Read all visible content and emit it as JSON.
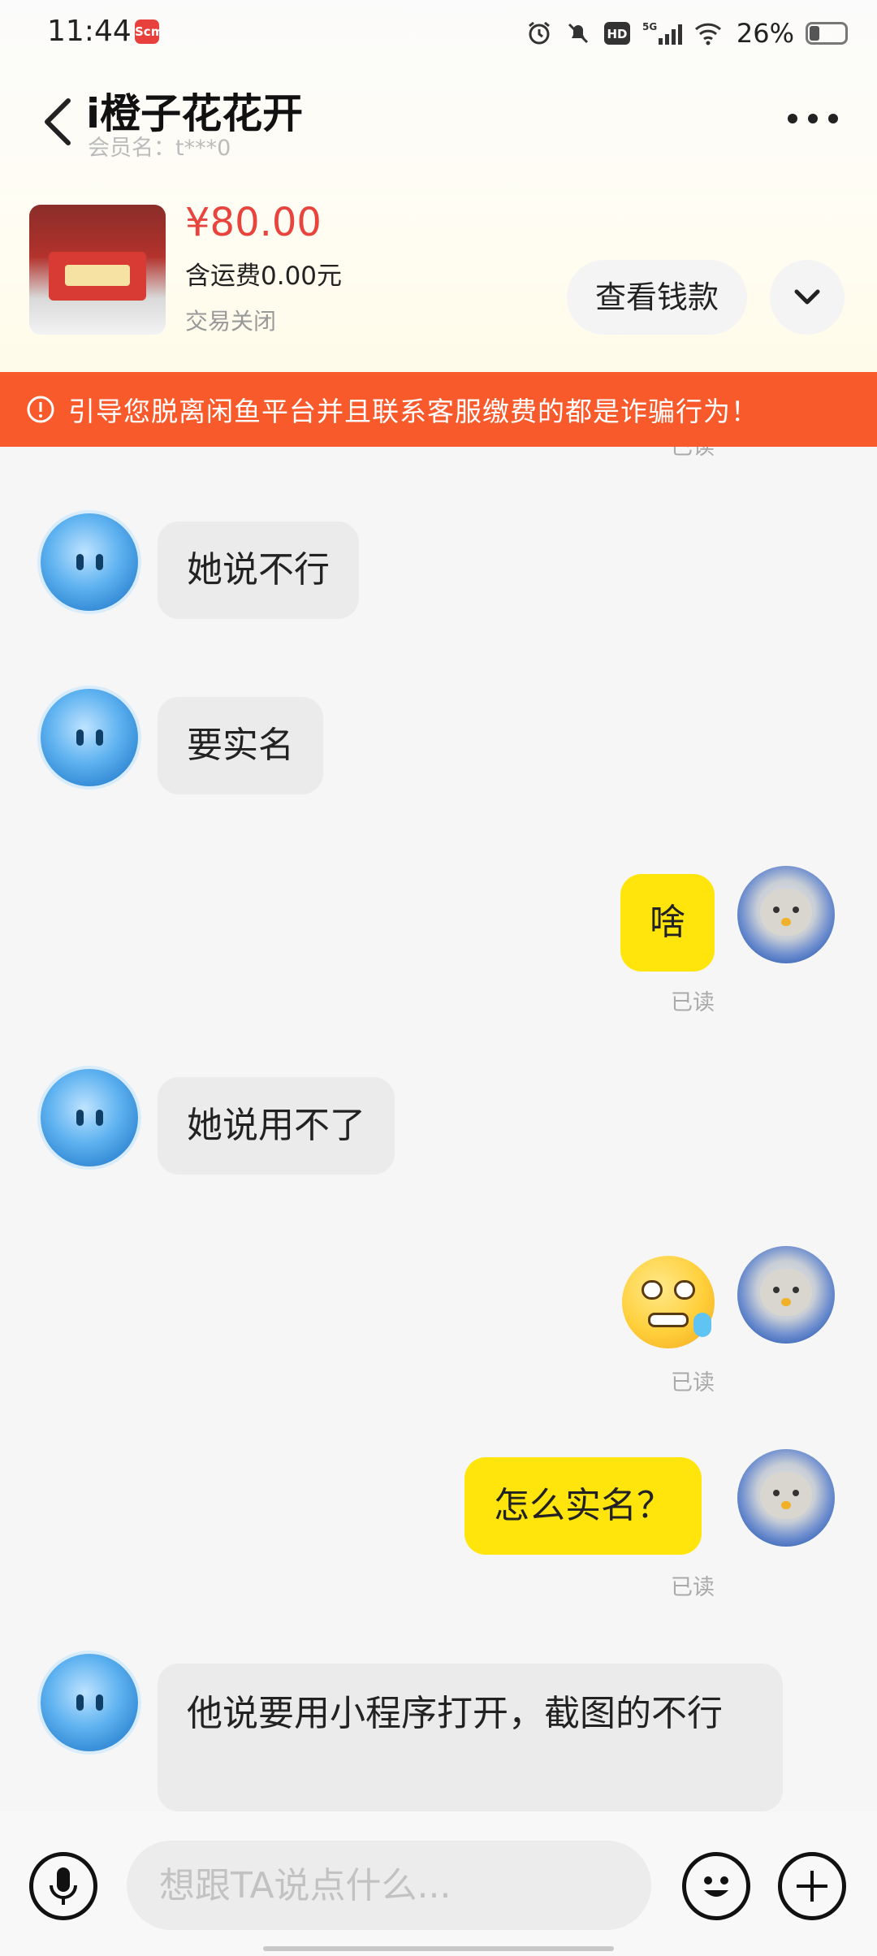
{
  "status_bar": {
    "time": "11:44",
    "app_badge": "Scm",
    "network": "5G",
    "hd": "HD",
    "battery": "26%"
  },
  "header": {
    "seller_name": "i橙子花花开",
    "member_label": "会员名：t***0"
  },
  "product": {
    "price": "¥80.00",
    "shipping": "含运费0.00元",
    "status": "交易关闭",
    "view_money_label": "查看钱款"
  },
  "warning": {
    "text": "引导您脱离闲鱼平台并且联系客服缴费的都是诈骗行为！"
  },
  "messages": [
    {
      "side": "right",
      "text": "",
      "read": "已读"
    },
    {
      "side": "left",
      "text": "她说不行"
    },
    {
      "side": "left",
      "text": "要实名"
    },
    {
      "side": "right",
      "text": "啥",
      "read": "已读"
    },
    {
      "side": "left",
      "text": "她说用不了"
    },
    {
      "side": "right",
      "text": "",
      "emoji": "sweat-smile-emoji",
      "read": "已读"
    },
    {
      "side": "right",
      "text": "怎么实名？",
      "read": "已读"
    },
    {
      "side": "left",
      "text": "他说要用小程序打开，截图的不行"
    }
  ],
  "input": {
    "placeholder": "想跟TA说点什么..."
  },
  "icons": {
    "back": "chevron-left-icon",
    "more": "more-dots-icon",
    "expand": "chevron-down-icon",
    "warning": "exclamation-circle-icon",
    "mic": "microphone-icon",
    "emoji": "smiley-icon",
    "plus": "plus-icon"
  },
  "colors": {
    "accent_red": "#e8433d",
    "warning_orange": "#f95a2c",
    "bubble_yellow": "#ffe50c",
    "bubble_gray": "#ebebeb"
  }
}
